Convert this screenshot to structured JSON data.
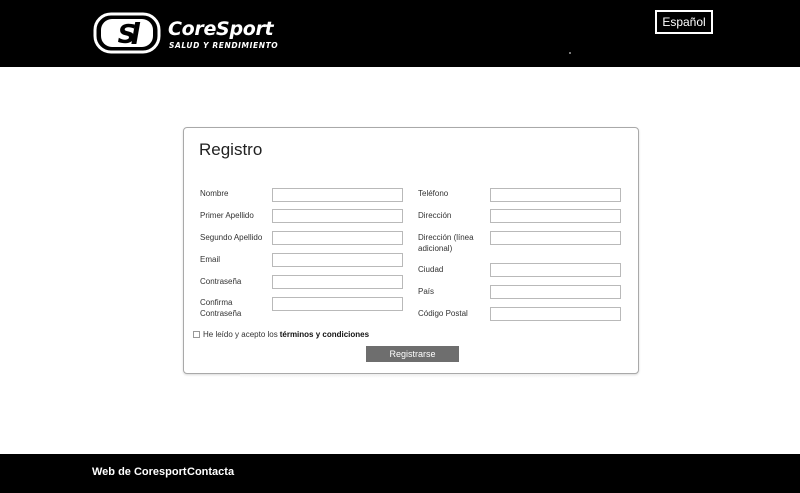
{
  "header": {
    "logo": {
      "name": "CoreSport",
      "tagline": "SALUD Y RENDIMIENTO"
    },
    "language_label": "Español"
  },
  "form": {
    "title": "Registro",
    "left_fields": [
      {
        "label": "Nombre",
        "value": ""
      },
      {
        "label": "Primer Apellido",
        "value": ""
      },
      {
        "label": "Segundo Apellido",
        "value": ""
      },
      {
        "label": "Email",
        "value": ""
      },
      {
        "label": "Contraseña",
        "value": ""
      },
      {
        "label": "Confirma Contraseña",
        "value": ""
      }
    ],
    "right_fields": [
      {
        "label": "Teléfono",
        "value": ""
      },
      {
        "label": "Dirección",
        "value": ""
      },
      {
        "label": "Dirección (línea adicional)",
        "value": ""
      },
      {
        "label": "Ciudad",
        "value": ""
      },
      {
        "label": "País",
        "value": ""
      },
      {
        "label": "Código Postal",
        "value": ""
      }
    ],
    "terms_prefix": "He leído y acepto los",
    "terms_link": "términos y condiciones",
    "submit_label": "Registrarse"
  },
  "footer": {
    "links": [
      "Web de Coresport",
      "Contacta"
    ]
  }
}
